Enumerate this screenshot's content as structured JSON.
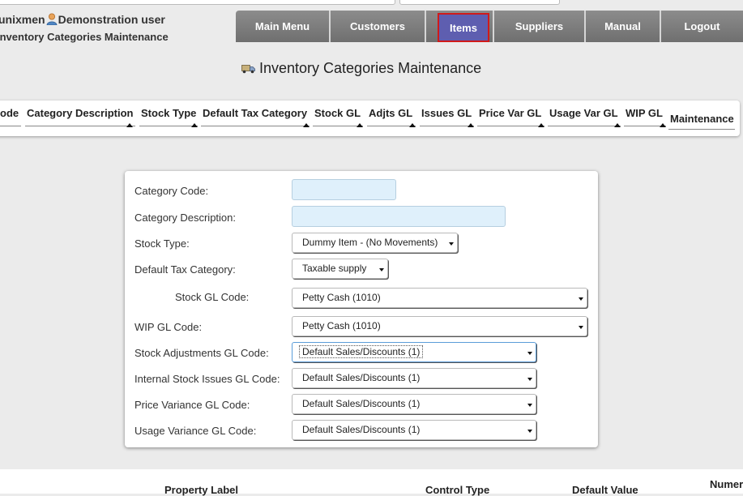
{
  "user": {
    "company": "unixmen",
    "name": "Demonstration user",
    "page": "Inventory Categories Maintenance"
  },
  "menu": [
    {
      "label": "Main Menu"
    },
    {
      "label": "Customers"
    },
    {
      "label": "Items"
    },
    {
      "label": "Suppliers"
    },
    {
      "label": "Manual"
    },
    {
      "label": "Logout"
    }
  ],
  "heading": "Inventory Categories Maintenance",
  "table": {
    "columns": [
      "ode",
      "Category Description",
      "Stock Type",
      "Default Tax Category",
      "Stock GL",
      "Adjts GL",
      "Issues GL",
      "Price Var GL",
      "Usage Var GL",
      "WIP GL",
      "Maintenance"
    ]
  },
  "form": {
    "category_code_label": "Category Code:",
    "category_code_value": "",
    "category_desc_label": "Category Description:",
    "category_desc_value": "",
    "stock_type_label": "Stock Type:",
    "stock_type_value": "Dummy Item - (No Movements)",
    "tax_label": "Default Tax Category:",
    "tax_value": "Taxable supply",
    "stock_gl_label": "Stock GL Code:",
    "stock_gl_value": "Petty Cash (1010)",
    "wip_gl_label": "WIP GL Code:",
    "wip_gl_value": "Petty Cash (1010)",
    "adj_gl_label": "Stock Adjustments GL Code:",
    "adj_gl_value": "Default Sales/Discounts (1)",
    "issues_gl_label": "Internal Stock Issues GL Code:",
    "issues_gl_value": "Default Sales/Discounts (1)",
    "pricevar_gl_label": "Price Variance GL Code:",
    "pricevar_gl_value": "Default Sales/Discounts (1)",
    "usagevar_gl_label": "Usage Variance GL Code:",
    "usagevar_gl_value": "Default Sales/Discounts (1)"
  },
  "bottom": {
    "col1": "Property Label",
    "col2": "Control Type",
    "col3": "Default Value",
    "col4": "Numer"
  },
  "colors": {
    "menu_bg": "#7a7a7a",
    "menu_active_bg": "#5e5eb0",
    "menu_active_border": "#d01a1a",
    "input_bg": "#dff0fb",
    "page_bg": "#ebebeb"
  },
  "icons": [
    "person-icon",
    "truck-icon"
  ]
}
